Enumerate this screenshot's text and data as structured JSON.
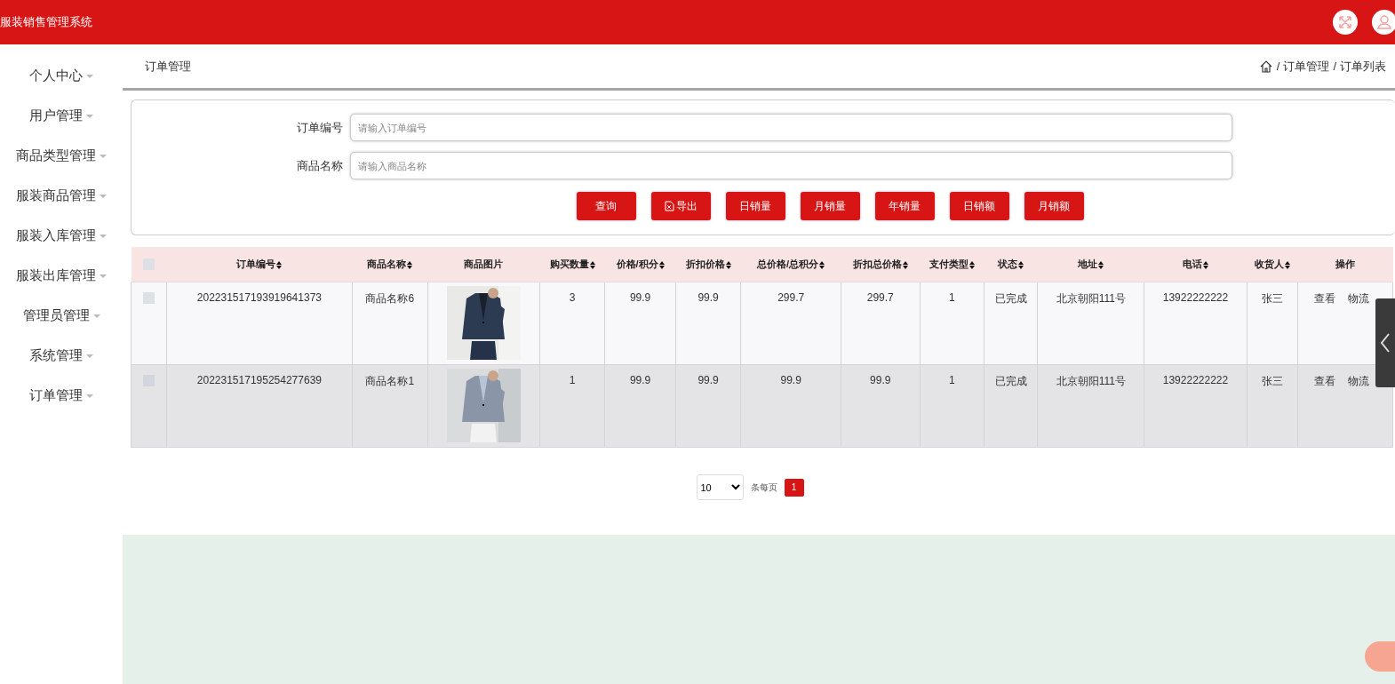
{
  "header": {
    "title": "服装销售管理系统"
  },
  "sidebar": {
    "items": [
      {
        "label": "个人中心"
      },
      {
        "label": "用户管理"
      },
      {
        "label": "商品类型管理"
      },
      {
        "label": "服装商品管理"
      },
      {
        "label": "服装入库管理"
      },
      {
        "label": "服装出库管理"
      },
      {
        "label": "管理员管理"
      },
      {
        "label": "系统管理"
      },
      {
        "label": "订单管理"
      }
    ]
  },
  "breadcrumb": {
    "title": "订单管理",
    "separator": "/",
    "path": [
      "订单管理",
      "订单列表"
    ]
  },
  "search": {
    "fields": [
      {
        "label": "订单编号",
        "placeholder": "请输入订单编号"
      },
      {
        "label": "商品名称",
        "placeholder": "请输入商品名称"
      }
    ],
    "buttons": [
      {
        "label": "查询",
        "kind": "plain"
      },
      {
        "label": "导出",
        "kind": "export"
      },
      {
        "label": "日销量",
        "kind": "plain"
      },
      {
        "label": "月销量",
        "kind": "plain"
      },
      {
        "label": "年销量",
        "kind": "plain"
      },
      {
        "label": "日销额",
        "kind": "plain"
      },
      {
        "label": "月销额",
        "kind": "plain"
      }
    ]
  },
  "table": {
    "select_all": {
      "checked": false
    },
    "columns": [
      {
        "label": "订单编号",
        "kind": "text",
        "sortable": true
      },
      {
        "label": "商品名称",
        "kind": "text",
        "sortable": true
      },
      {
        "label": "商品图片",
        "kind": "picture",
        "sortable": false
      },
      {
        "label": "购买数量",
        "kind": "text",
        "sortable": true
      },
      {
        "label": "价格/积分",
        "kind": "text",
        "sortable": true
      },
      {
        "label": "折扣价格",
        "kind": "text",
        "sortable": true
      },
      {
        "label": "总价格/总积分",
        "kind": "text",
        "sortable": true
      },
      {
        "label": "折扣总价格",
        "kind": "text",
        "sortable": true
      },
      {
        "label": "支付类型",
        "kind": "text",
        "sortable": true
      },
      {
        "label": "状态",
        "kind": "text",
        "sortable": true
      },
      {
        "label": "地址",
        "kind": "text",
        "sortable": true
      },
      {
        "label": "电话",
        "kind": "text",
        "sortable": true
      },
      {
        "label": "收货人",
        "kind": "text",
        "sortable": true
      },
      {
        "label": "操作",
        "kind": "actions",
        "sortable": false
      }
    ],
    "rows": [
      {
        "checked": false,
        "highlighted": false,
        "cells": [
          "202231517193919641373",
          "商品名称6",
          {
            "kind": "picture"
          },
          "3",
          "99.9",
          "99.9",
          "299.7",
          "299.7",
          "1",
          "已完成",
          "北京朝阳111号",
          "13922222222",
          "张三",
          [
            "查看",
            "物流"
          ]
        ]
      },
      {
        "checked": false,
        "highlighted": true,
        "cells": [
          "202231517195254277639",
          "商品名称1",
          {
            "kind": "picture"
          },
          "1",
          "99.9",
          "99.9",
          "99.9",
          "99.9",
          "1",
          "已完成",
          "北京朝阳111号",
          "13922222222",
          "张三",
          [
            "查看",
            "物流"
          ]
        ]
      }
    ]
  },
  "pagination": {
    "page_size": "10",
    "size_label": "条每页",
    "pages": [
      {
        "label": "1",
        "selected": true
      }
    ]
  }
}
